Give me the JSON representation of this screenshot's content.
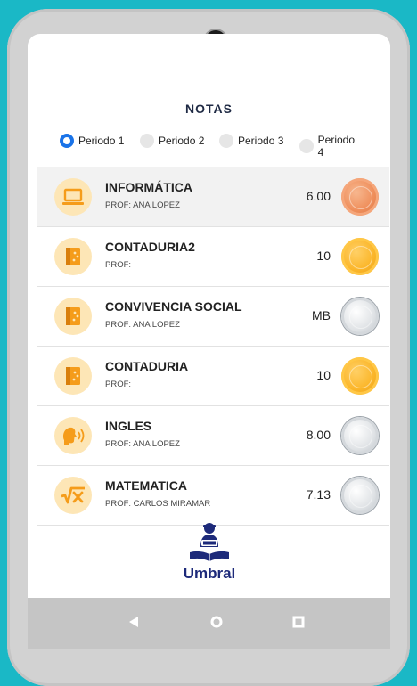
{
  "screen": {
    "title": "NOTAS"
  },
  "periods": [
    {
      "label": "Periodo 1",
      "selected": true
    },
    {
      "label": "Periodo 2",
      "selected": false
    },
    {
      "label": "Periodo 3",
      "selected": false
    },
    {
      "label": "Periodo 4",
      "selected": false
    }
  ],
  "subjects": [
    {
      "name": "INFORMÁTICA",
      "teacher": "PROF: ANA LOPEZ",
      "grade": "6.00",
      "icon": "laptop-icon",
      "medal": "bronze"
    },
    {
      "name": "CONTADURIA2",
      "teacher": "PROF:",
      "grade": "10",
      "icon": "book-icon",
      "medal": "gold"
    },
    {
      "name": "CONVIVENCIA SOCIAL",
      "teacher": "PROF: ANA LOPEZ",
      "grade": "MB",
      "icon": "book-icon",
      "medal": "silver"
    },
    {
      "name": "CONTADURIA",
      "teacher": "PROF:",
      "grade": "10",
      "icon": "book-icon",
      "medal": "gold"
    },
    {
      "name": "INGLES",
      "teacher": "PROF: ANA LOPEZ",
      "grade": "8.00",
      "icon": "speaking-head-icon",
      "medal": "silver"
    },
    {
      "name": "MATEMATICA",
      "teacher": "PROF: CARLOS MIRAMAR",
      "grade": "7.13",
      "icon": "square-root-icon",
      "medal": "silver"
    }
  ],
  "logo": {
    "text": "Umbral"
  },
  "colors": {
    "background": "#1ab8c6",
    "accent": "#1a73e8",
    "icon_bg": "#fde6b6",
    "icon_fg": "#f59c1a",
    "brand": "#1d2a7a"
  }
}
